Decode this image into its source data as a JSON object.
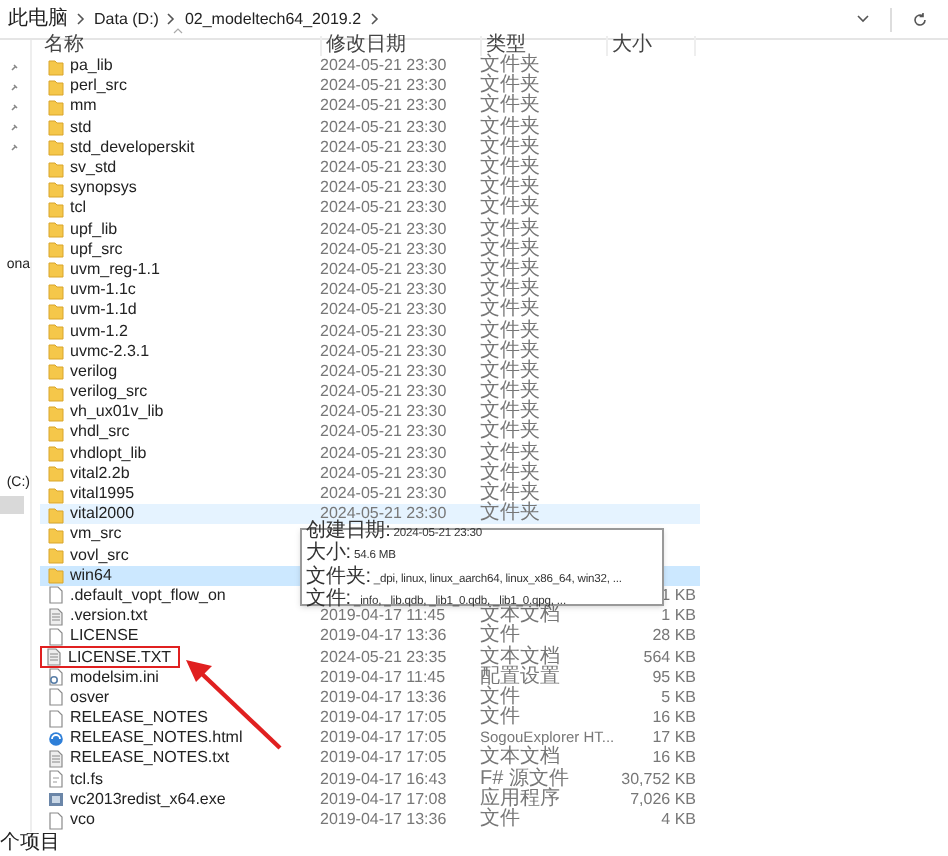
{
  "breadcrumb": [
    "此电脑",
    "Data (D:)",
    "02_modeltech64_2019.2"
  ],
  "columns": [
    "名称",
    "修改日期",
    "类型",
    "大小"
  ],
  "nav_pane": {
    "items": [
      {
        "label": "ona"
      },
      {
        "label": "(C:)"
      }
    ]
  },
  "rows": [
    {
      "kind": "folder",
      "name": "pa_lib",
      "date": "2024-05-21 23:30",
      "type": "文件夹",
      "selected": false,
      "hovered": false,
      "boxed": false
    },
    {
      "kind": "folder",
      "name": "perl_src",
      "date": "2024-05-21 23:30",
      "type": "文件夹",
      "selected": false,
      "hovered": false,
      "boxed": false
    },
    {
      "kind": "folder",
      "name": "mm",
      "date": "2024-05-21 23:30",
      "type": "文件夹",
      "selected": false,
      "hovered": false,
      "boxed": false
    },
    {
      "kind": "folder",
      "name": "std",
      "date": "2024-05-21 23:30",
      "type": "文件夹",
      "selected": false,
      "hovered": false,
      "boxed": false
    },
    {
      "kind": "folder",
      "name": "std_developerskit",
      "date": "2024-05-21 23:30",
      "type": "文件夹",
      "selected": false,
      "hovered": false,
      "boxed": false
    },
    {
      "kind": "folder",
      "name": "sv_std",
      "date": "2024-05-21 23:30",
      "type": "文件夹",
      "selected": false,
      "hovered": false,
      "boxed": false
    },
    {
      "kind": "folder",
      "name": "synopsys",
      "date": "2024-05-21 23:30",
      "type": "文件夹",
      "selected": false,
      "hovered": false,
      "boxed": false
    },
    {
      "kind": "folder",
      "name": "tcl",
      "date": "2024-05-21 23:30",
      "type": "文件夹",
      "selected": false,
      "hovered": false,
      "boxed": false
    },
    {
      "kind": "folder",
      "name": "upf_lib",
      "date": "2024-05-21 23:30",
      "type": "文件夹",
      "selected": false,
      "hovered": false,
      "boxed": false
    },
    {
      "kind": "folder",
      "name": "upf_src",
      "date": "2024-05-21 23:30",
      "type": "文件夹",
      "selected": false,
      "hovered": false,
      "boxed": false
    },
    {
      "kind": "folder",
      "name": "uvm_reg-1.1",
      "date": "2024-05-21 23:30",
      "type": "文件夹",
      "selected": false,
      "hovered": false,
      "boxed": false
    },
    {
      "kind": "folder",
      "name": "uvm-1.1c",
      "date": "2024-05-21 23:30",
      "type": "文件夹",
      "selected": false,
      "hovered": false,
      "boxed": false
    },
    {
      "kind": "folder",
      "name": "uvm-1.1d",
      "date": "2024-05-21 23:30",
      "type": "文件夹",
      "selected": false,
      "hovered": false,
      "boxed": false
    },
    {
      "kind": "folder",
      "name": "uvm-1.2",
      "date": "2024-05-21 23:30",
      "type": "文件夹",
      "selected": false,
      "hovered": false,
      "boxed": false
    },
    {
      "kind": "folder",
      "name": "uvmc-2.3.1",
      "date": "2024-05-21 23:30",
      "type": "文件夹",
      "selected": false,
      "hovered": false,
      "boxed": false
    },
    {
      "kind": "folder",
      "name": "verilog",
      "date": "2024-05-21 23:30",
      "type": "文件夹",
      "selected": false,
      "hovered": false,
      "boxed": false
    },
    {
      "kind": "folder",
      "name": "verilog_src",
      "date": "2024-05-21 23:30",
      "type": "文件夹",
      "selected": false,
      "hovered": false,
      "boxed": false
    },
    {
      "kind": "folder",
      "name": "vh_ux01v_lib",
      "date": "2024-05-21 23:30",
      "type": "文件夹",
      "selected": false,
      "hovered": false,
      "boxed": false
    },
    {
      "kind": "folder",
      "name": "vhdl_src",
      "date": "2024-05-21 23:30",
      "type": "文件夹",
      "selected": false,
      "hovered": false,
      "boxed": false
    },
    {
      "kind": "folder",
      "name": "vhdlopt_lib",
      "date": "2024-05-21 23:30",
      "type": "文件夹",
      "selected": false,
      "hovered": false,
      "boxed": false
    },
    {
      "kind": "folder",
      "name": "vital2.2b",
      "date": "2024-05-21 23:30",
      "type": "文件夹",
      "selected": false,
      "hovered": false,
      "boxed": false
    },
    {
      "kind": "folder",
      "name": "vital1995",
      "date": "2024-05-21 23:30",
      "type": "文件夹",
      "selected": false,
      "hovered": false,
      "boxed": false
    },
    {
      "kind": "folder",
      "name": "vital2000",
      "date": "2024-05-21 23:30",
      "type": "文件夹",
      "selected": false,
      "hovered": true,
      "boxed": false
    },
    {
      "kind": "folder",
      "name": "vm_src",
      "selected": false,
      "hovered": false,
      "boxed": false
    },
    {
      "kind": "folder",
      "name": "vovl_src",
      "selected": false,
      "hovered": false,
      "boxed": false
    },
    {
      "kind": "folder",
      "name": "win64",
      "selected": true,
      "hovered": false,
      "boxed": false
    },
    {
      "kind": "file",
      "name": ".default_vopt_flow_on",
      "size": "1 KB",
      "selected": false,
      "hovered": false,
      "boxed": false
    },
    {
      "kind": "text",
      "name": ".version.txt",
      "date": "2019-04-17 11:45",
      "type": "文本文档",
      "size": "1 KB",
      "selected": false,
      "hovered": false,
      "boxed": false
    },
    {
      "kind": "file",
      "name": "LICENSE",
      "date": "2019-04-17 13:36",
      "type": "文件",
      "size": "28 KB",
      "selected": false,
      "hovered": false,
      "boxed": false
    },
    {
      "kind": "text",
      "name": "LICENSE.TXT",
      "date": "2024-05-21 23:35",
      "type": "文本文档",
      "size": "564 KB",
      "selected": false,
      "hovered": false,
      "boxed": true
    },
    {
      "kind": "config",
      "name": "modelsim.ini",
      "date": "2019-04-17 11:45",
      "type": "配置设置",
      "size": "95 KB",
      "selected": false,
      "hovered": false,
      "boxed": false
    },
    {
      "kind": "file",
      "name": "osver",
      "date": "2019-04-17 13:36",
      "type": "文件",
      "size": "5 KB",
      "selected": false,
      "hovered": false,
      "boxed": false
    },
    {
      "kind": "file",
      "name": "RELEASE_NOTES",
      "date": "2019-04-17 17:05",
      "type": "文件",
      "size": "16 KB",
      "selected": false,
      "hovered": false,
      "boxed": false
    },
    {
      "kind": "web",
      "name": "RELEASE_NOTES.html",
      "date": "2019-04-17 17:05",
      "type": "SogouExplorer HT...",
      "size": "17 KB",
      "selected": false,
      "hovered": false,
      "boxed": false
    },
    {
      "kind": "text",
      "name": "RELEASE_NOTES.txt",
      "date": "2019-04-17 17:05",
      "type": "文本文档",
      "size": "16 KB",
      "selected": false,
      "hovered": false,
      "boxed": false
    },
    {
      "kind": "script",
      "name": "tcl.fs",
      "date": "2019-04-17 16:43",
      "type": "F# 源文件",
      "size": "30,752 KB",
      "selected": false,
      "hovered": false,
      "boxed": false
    },
    {
      "kind": "exe",
      "name": "vc2013redist_x64.exe",
      "date": "2019-04-17 17:08",
      "type": "应用程序",
      "size": "7,026 KB",
      "selected": false,
      "hovered": false,
      "boxed": false
    },
    {
      "kind": "file",
      "name": "vco",
      "date": "2019-04-17 13:36",
      "type": "文件",
      "size": "4 KB",
      "selected": false,
      "hovered": false,
      "boxed": false
    }
  ],
  "tooltip": {
    "lines": [
      {
        "label": "创建日期:",
        "value": "2024-05-21 23:30"
      },
      {
        "label": "大小:",
        "value": "54.6 MB"
      },
      {
        "label": "文件夹:",
        "value": "_dpi, linux, linux_aarch64, linux_x86_64, win32, ..."
      },
      {
        "label": "文件:",
        "value": "_info, _lib.qdb, _lib1_0.qdb, _lib1_0.qpg, ..."
      }
    ]
  },
  "status_bar": {
    "text": "个项目"
  }
}
